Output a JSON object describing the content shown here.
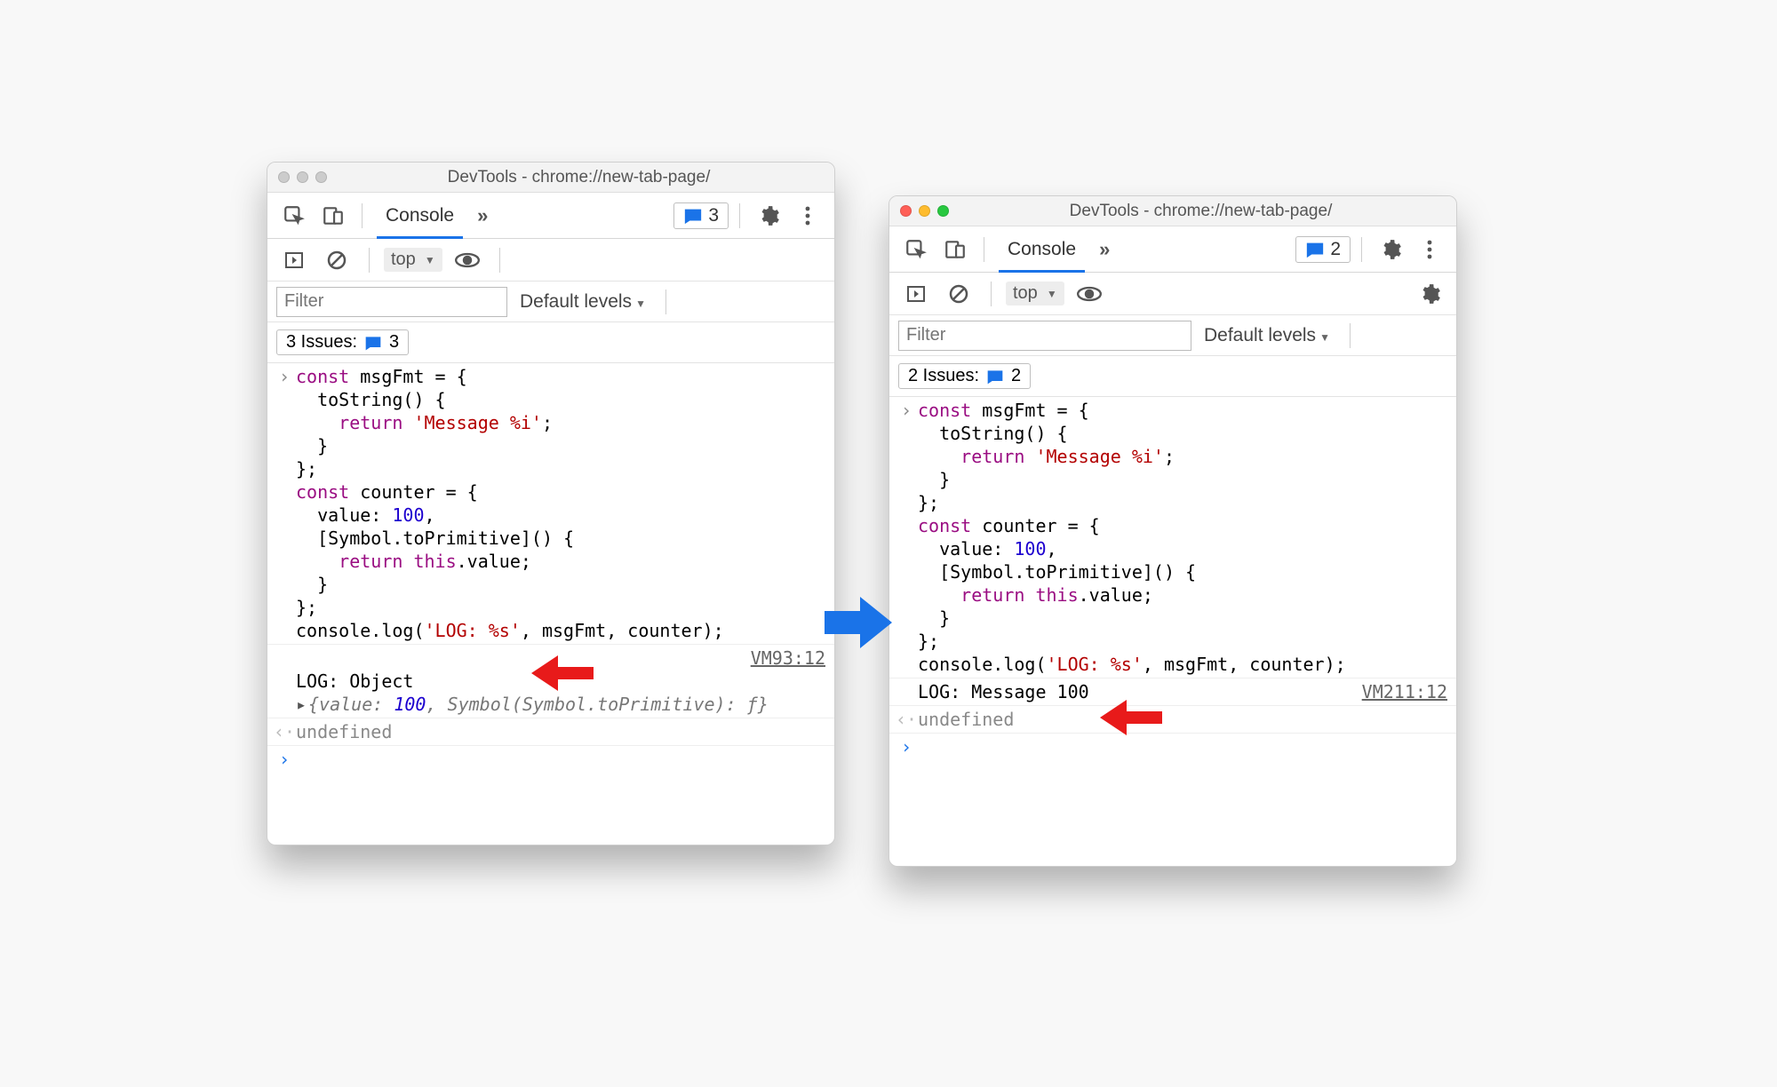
{
  "left": {
    "title": "DevTools - chrome://new-tab-page/",
    "tab": "Console",
    "issue_count": "3",
    "context": "top",
    "filter_placeholder": "Filter",
    "levels": "Default levels",
    "issues_label": "3 Issues:",
    "issues_badge": "3",
    "code": {
      "l1": "const msgFmt = {",
      "l2": "  toString() {",
      "l3": "    return 'Message %i';",
      "l3_ret": "return",
      "l3_str": "'Message %i'",
      "l4": "  }",
      "l5": "};",
      "l6": "const counter = {",
      "l7a": "  value: ",
      "l7n": "100",
      "l7b": ",",
      "l8": "  [Symbol.toPrimitive]() {",
      "l9a": "    ",
      "l9ret": "return",
      "l9sp": " ",
      "l9this": "this",
      "l9b": ".value;",
      "l10": "  }",
      "l11": "};",
      "l12a": "console.log(",
      "l12s": "'LOG: %s'",
      "l12b": ", msgFmt, counter);"
    },
    "log_line": "LOG: Object",
    "obj_preview_a": "{value: ",
    "obj_preview_n": "100",
    "obj_preview_b": ", Symbol(Symbol.toPrimitive): ƒ}",
    "log_src": "VM93:12",
    "undef": "undefined"
  },
  "right": {
    "title": "DevTools - chrome://new-tab-page/",
    "tab": "Console",
    "issue_count": "2",
    "context": "top",
    "filter_placeholder": "Filter",
    "levels": "Default levels",
    "issues_label": "2 Issues:",
    "issues_badge": "2",
    "code": {
      "l1": "const msgFmt = {",
      "l2": "  toString() {",
      "l3_ret": "return",
      "l3_str": "'Message %i'",
      "l4": "  }",
      "l5": "};",
      "l6": "const counter = {",
      "l7a": "  value: ",
      "l7n": "100",
      "l7b": ",",
      "l8": "  [Symbol.toPrimitive]() {",
      "l9ret": "return",
      "l9this": "this",
      "l9b": ".value;",
      "l10": "  }",
      "l11": "};",
      "l12a": "console.log(",
      "l12s": "'LOG: %s'",
      "l12b": ", msgFmt, counter);"
    },
    "log_line": "LOG: Message 100",
    "log_src": "VM211:12",
    "undef": "undefined"
  }
}
